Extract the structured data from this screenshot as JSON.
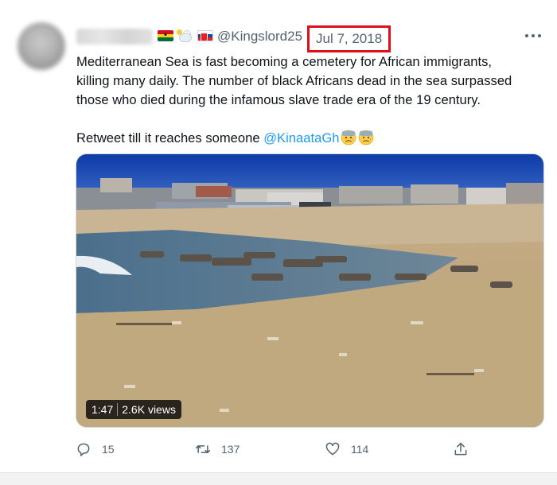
{
  "tweet": {
    "handle": "@Kingslord25",
    "date": "Jul 7, 2018",
    "text_line1": "Mediterranean Sea is fast becoming a cemetery for African immigrants,",
    "text_line2": "killing many daily. The number of black Africans dead in the sea surpassed",
    "text_line3": "those who died during the infamous slave trade era of the 19 century.",
    "text_line4_prefix": "Retweet till it reaches someone ",
    "mention": "@KinaataGh",
    "flags": [
      "ghana-flag-icon",
      "sun-behind-cloud-icon",
      "slovakia-flag-icon"
    ],
    "emojis": [
      "anxious-face-icon",
      "anxious-face-icon"
    ]
  },
  "video": {
    "duration": "1:47",
    "views": "2.6K views"
  },
  "actions": {
    "replies": "15",
    "retweets": "137",
    "likes": "114"
  },
  "colors": {
    "accent": "#1d9bf0",
    "highlight_box": "#e0101b",
    "muted_text": "#536471"
  }
}
